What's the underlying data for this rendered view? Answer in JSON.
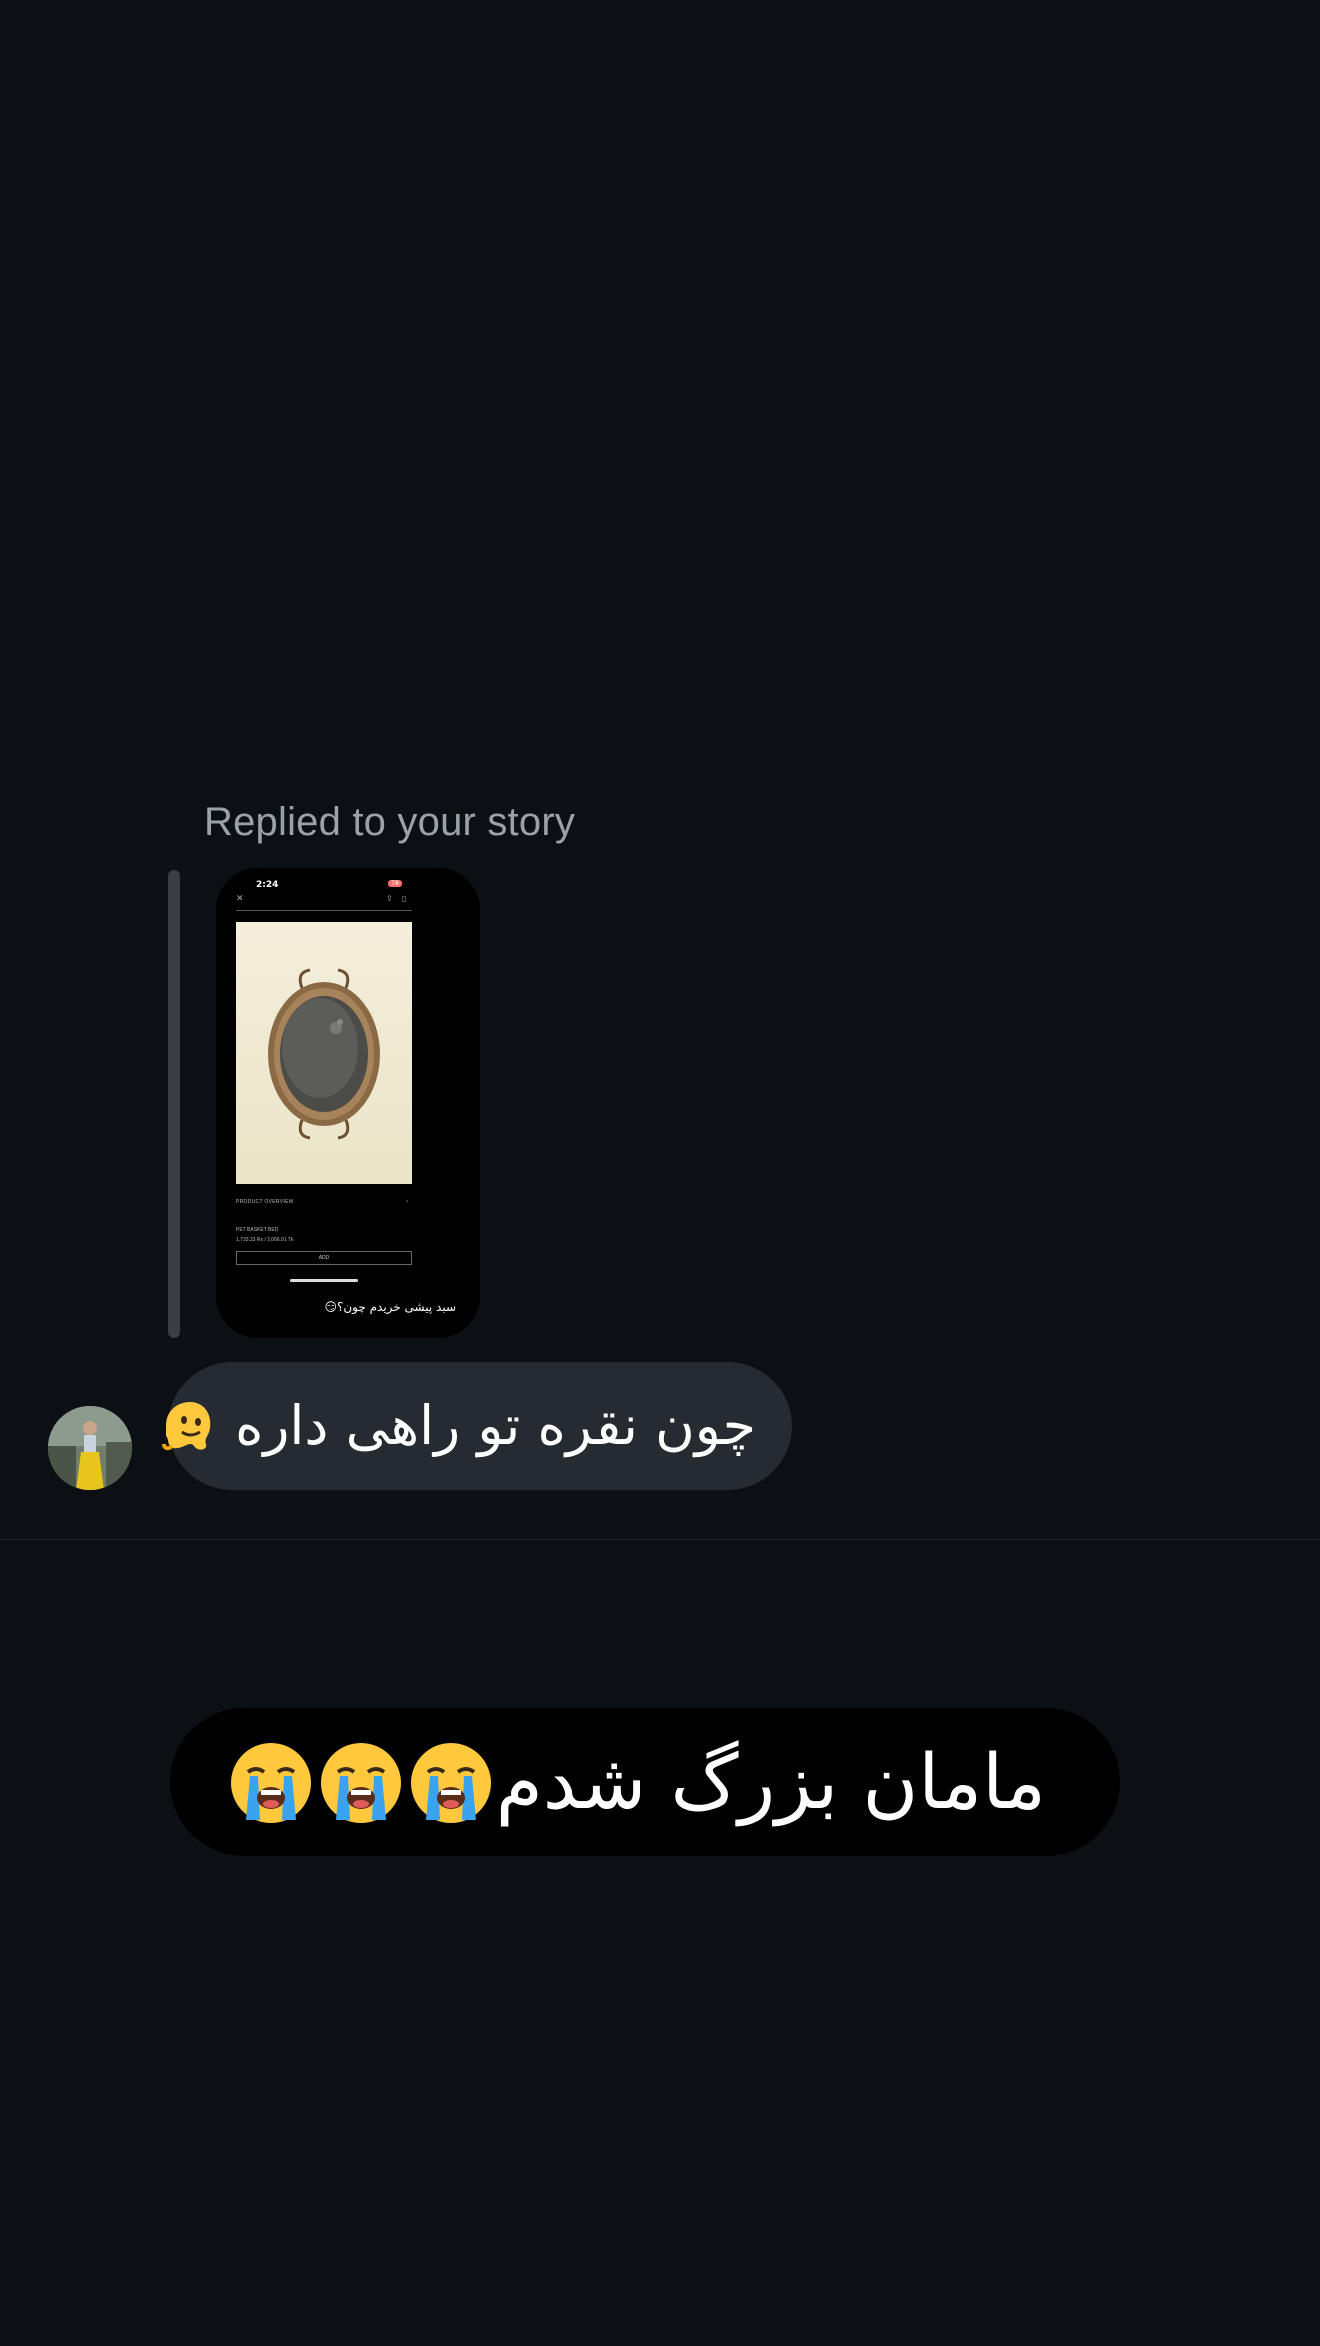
{
  "reply_context": {
    "label": "Replied to your story"
  },
  "story_preview": {
    "time": "2:24",
    "battery": "78",
    "section_title": "PRODUCT OVERVIEW",
    "product_name": "PET BASKET BED",
    "price": "1,733.33 Rs  /  2,066.01 Tk",
    "add_button": "ADD",
    "caption": "سبد پیشی خریدم چون؟"
  },
  "messages": {
    "received": {
      "text": "چون نقره تو راهی داره",
      "emoji": "melting-face"
    },
    "sent": {
      "text": "مامان بزرگ شدم",
      "emoji": "loudly-crying-face",
      "emoji_count": 3
    }
  },
  "colors": {
    "background": "#0c0f14",
    "received_bubble": "#262a31",
    "sent_bubble": "#000000",
    "label_gray": "#9ba1aa"
  }
}
